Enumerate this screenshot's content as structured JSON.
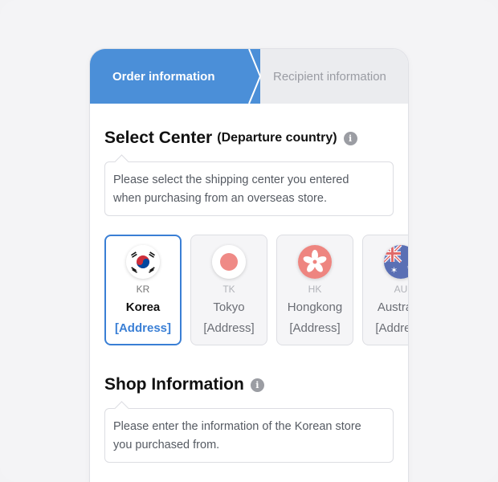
{
  "steps": {
    "active": "Order information",
    "next": "Recipient information"
  },
  "select_center": {
    "title": "Select Center",
    "subtitle": "(Departure country)",
    "info_icon": "info-icon",
    "note_line1": "Please select the shipping center you entered",
    "note_line2": "when purchasing from an overseas store."
  },
  "centers": [
    {
      "code": "KR",
      "name": "Korea",
      "address": "[Address]",
      "selected": true,
      "icon": "korea-flag-icon"
    },
    {
      "code": "TK",
      "name": "Tokyo",
      "address": "[Address]",
      "selected": false,
      "icon": "japan-flag-icon"
    },
    {
      "code": "HK",
      "name": "Hongkong",
      "address": "[Address]",
      "selected": false,
      "icon": "hongkong-flag-icon"
    },
    {
      "code": "AU",
      "name": "Australia",
      "address": "[Address]",
      "selected": false,
      "icon": "australia-flag-icon"
    }
  ],
  "shop_info": {
    "title": "Shop Information",
    "info_icon": "info-icon",
    "note_line1": "Please enter the information of the Korean store",
    "note_line2": "you purchased from."
  },
  "colors": {
    "accent": "#4b8fd8",
    "selected_border": "#3a7fd5"
  }
}
